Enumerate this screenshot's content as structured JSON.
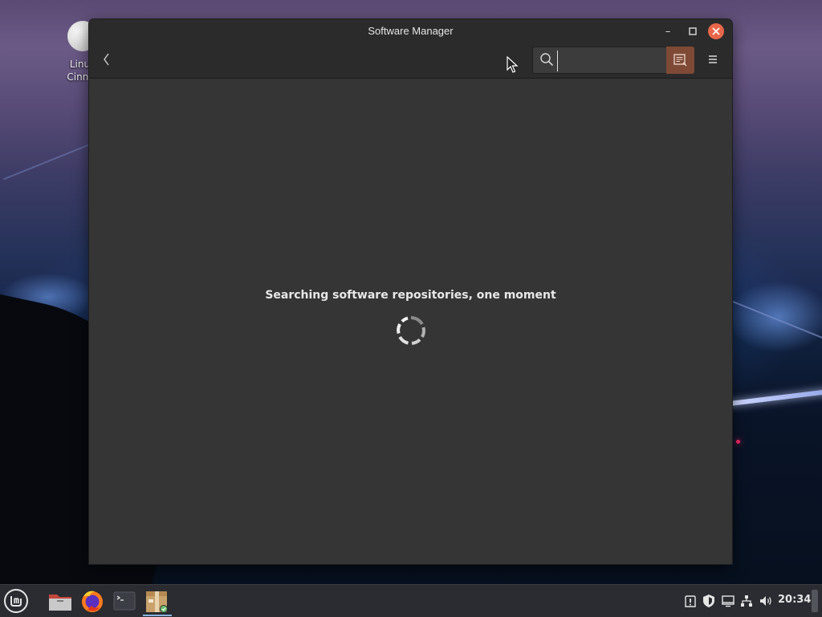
{
  "desktop": {
    "icon_label_line1": "Linux",
    "icon_label_line2": "Cinnar"
  },
  "window": {
    "title": "Software Manager",
    "minimize_symbol": "–",
    "maximize_symbol": "□",
    "close_symbol": "✕",
    "back_symbol": "‹",
    "search": {
      "value": "",
      "placeholder": ""
    },
    "accent_color": "#e8674a",
    "filter_button_color": "#7e4a36"
  },
  "content": {
    "status_message": "Searching software repositories, one moment"
  },
  "taskbar": {
    "pinned": [
      {
        "name": "files",
        "icon": "folder-icon"
      },
      {
        "name": "firefox",
        "icon": "firefox-icon"
      },
      {
        "name": "terminal",
        "icon": "terminal-icon"
      },
      {
        "name": "software-manager",
        "icon": "package-icon",
        "active": true
      }
    ],
    "tray": [
      "update-manager-icon",
      "shield-icon",
      "display-icon",
      "network-icon",
      "volume-icon"
    ],
    "clock": "20:34"
  }
}
